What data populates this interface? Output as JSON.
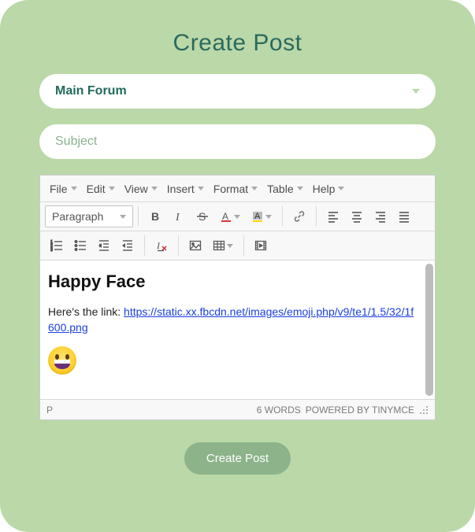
{
  "pageTitle": "Create Post",
  "forumSelect": {
    "value": "Main Forum"
  },
  "subject": {
    "placeholder": "Subject",
    "value": ""
  },
  "menubar": {
    "file": "File",
    "edit": "Edit",
    "view": "View",
    "insert": "Insert",
    "format": "Format",
    "table": "Table",
    "help": "Help"
  },
  "toolbar": {
    "formatSelect": "Paragraph"
  },
  "body": {
    "heading": "Happy Face",
    "intro": "Here's the link: ",
    "linkText": "https://static.xx.fbcdn.net/images/emoji.php/v9/te1/1.5/32/1f600.png",
    "linkHref": "https://static.xx.fbcdn.net/images/emoji.php/v9/te1/1.5/32/1f600.png"
  },
  "status": {
    "path": "P",
    "wordsLabel": "6 WORDS",
    "powered": "POWERED BY TINYMCE"
  },
  "submitLabel": "Create Post"
}
